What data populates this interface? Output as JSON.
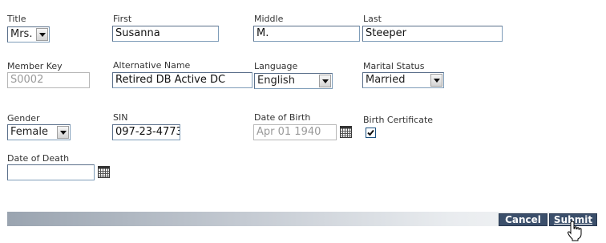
{
  "form": {
    "title": {
      "label": "Title",
      "value": "Mrs."
    },
    "first": {
      "label": "First",
      "value": "Susanna"
    },
    "middle": {
      "label": "Middle",
      "value": "M."
    },
    "last": {
      "label": "Last",
      "value": "Steeper"
    },
    "member_key": {
      "label": "Member Key",
      "value": "S0002"
    },
    "alt_name": {
      "label": "Alternative Name",
      "value": "Retired DB Active DC"
    },
    "language": {
      "label": "Language",
      "value": "English"
    },
    "marital": {
      "label": "Marital Status",
      "value": "Married"
    },
    "gender": {
      "label": "Gender",
      "value": "Female"
    },
    "sin": {
      "label": "SIN",
      "value": "097-23-4773"
    },
    "dob": {
      "label": "Date of Birth",
      "value": "Apr 01 1940"
    },
    "birth_cert": {
      "label": "Birth Certificate",
      "checked": true
    },
    "dod": {
      "label": "Date of Death",
      "value": ""
    }
  },
  "actions": {
    "cancel": "Cancel",
    "submit": "Submit"
  },
  "icons": {
    "calendar": "calendar-icon",
    "cursor": "hand-pointer-cursor"
  },
  "colors": {
    "button_bg": "#3b4f6b",
    "input_border": "#7f9db9"
  }
}
